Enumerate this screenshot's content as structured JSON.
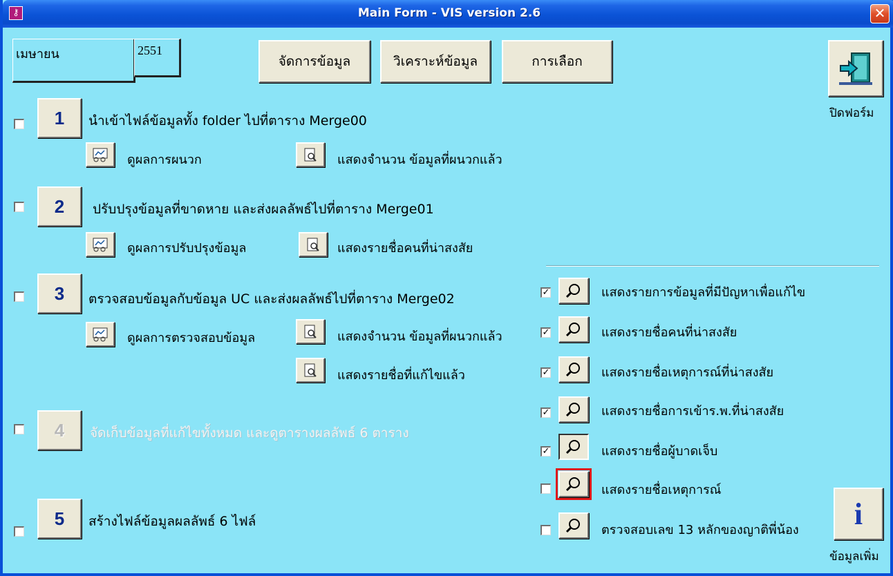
{
  "window": {
    "title": "Main Form - VIS version 2.6",
    "close_glyph": "✕"
  },
  "top": {
    "month": "เมษายน",
    "year": "2551",
    "buttons": [
      "จัดการข้อมูล",
      "วิเคราะห์ข้อมูล",
      "การเลือก"
    ],
    "close_form_label": "ปิดฟอร์ม",
    "more_info_label": "ข้อมูลเพิ่ม",
    "info_glyph": "i"
  },
  "steps": [
    {
      "num": "1",
      "checked": false,
      "enabled": true,
      "label": "นำเข้าไฟล์ข้อมูลทั้ง folder ไปที่ตาราง Merge00"
    },
    {
      "num": "2",
      "checked": false,
      "enabled": true,
      "label": "ปรับปรุงข้อมูลที่ขาดหาย และส่งผลลัพธ์ไปที่ตาราง Merge01"
    },
    {
      "num": "3",
      "checked": false,
      "enabled": true,
      "label": "ตรวจสอบข้อมูลกับข้อมูล UC และส่งผลลัพธ์ไปที่ตาราง Merge02"
    },
    {
      "num": "4",
      "checked": false,
      "enabled": false,
      "label": "จัดเก็บข้อมูลที่แก้ไขทั้งหมด และดูตารางผลลัพธ์ 6 ตาราง"
    },
    {
      "num": "5",
      "checked": false,
      "enabled": true,
      "label": "สร้างไฟล์ข้อมูลผลลัพธ์ 6 ไฟล์"
    }
  ],
  "sub": {
    "s1_view": "ดูผลการผนวก",
    "s1_count": "แสดงจำนวน ข้อมูลที่ผนวกแล้ว",
    "s2_view": "ดูผลการปรับปรุงข้อมูล",
    "s2_list": "แสดงรายชื่อคนที่น่าสงสัย",
    "s3_view": "ดูผลการตรวจสอบข้อมูล",
    "s3_count": "แสดงจำนวน ข้อมูลที่ผนวกแล้ว",
    "s3_fixed": "แสดงรายชื่อที่แก้ไขแล้ว"
  },
  "reports": [
    {
      "checked": true,
      "label": "แสดงรายการข้อมูลที่มีปัญหาเพื่อแก้ไข",
      "state": "normal"
    },
    {
      "checked": true,
      "label": "แสดงรายชื่อคนที่น่าสงสัย",
      "state": "normal"
    },
    {
      "checked": true,
      "label": "แสดงรายชื่อเหตุการณ์ที่น่าสงสัย",
      "state": "normal"
    },
    {
      "checked": true,
      "label": "แสดงรายชื่อการเข้าร.พ.ที่น่าสงสัย",
      "state": "normal"
    },
    {
      "checked": true,
      "label": "แสดงรายชื่อผู้บาดเจ็บ",
      "state": "pressed"
    },
    {
      "checked": false,
      "label": "แสดงรายชื่อเหตุการณ์",
      "state": "highlighted"
    },
    {
      "checked": false,
      "label": "ตรวจสอบเลข 13 หลักของญาติพี่น้อง",
      "state": "normal"
    }
  ],
  "colors": {
    "form_bg": "#8be4f7",
    "title_bar": "#0b53d6",
    "step_number": "#0c2a8a",
    "highlight": "#e01818"
  }
}
